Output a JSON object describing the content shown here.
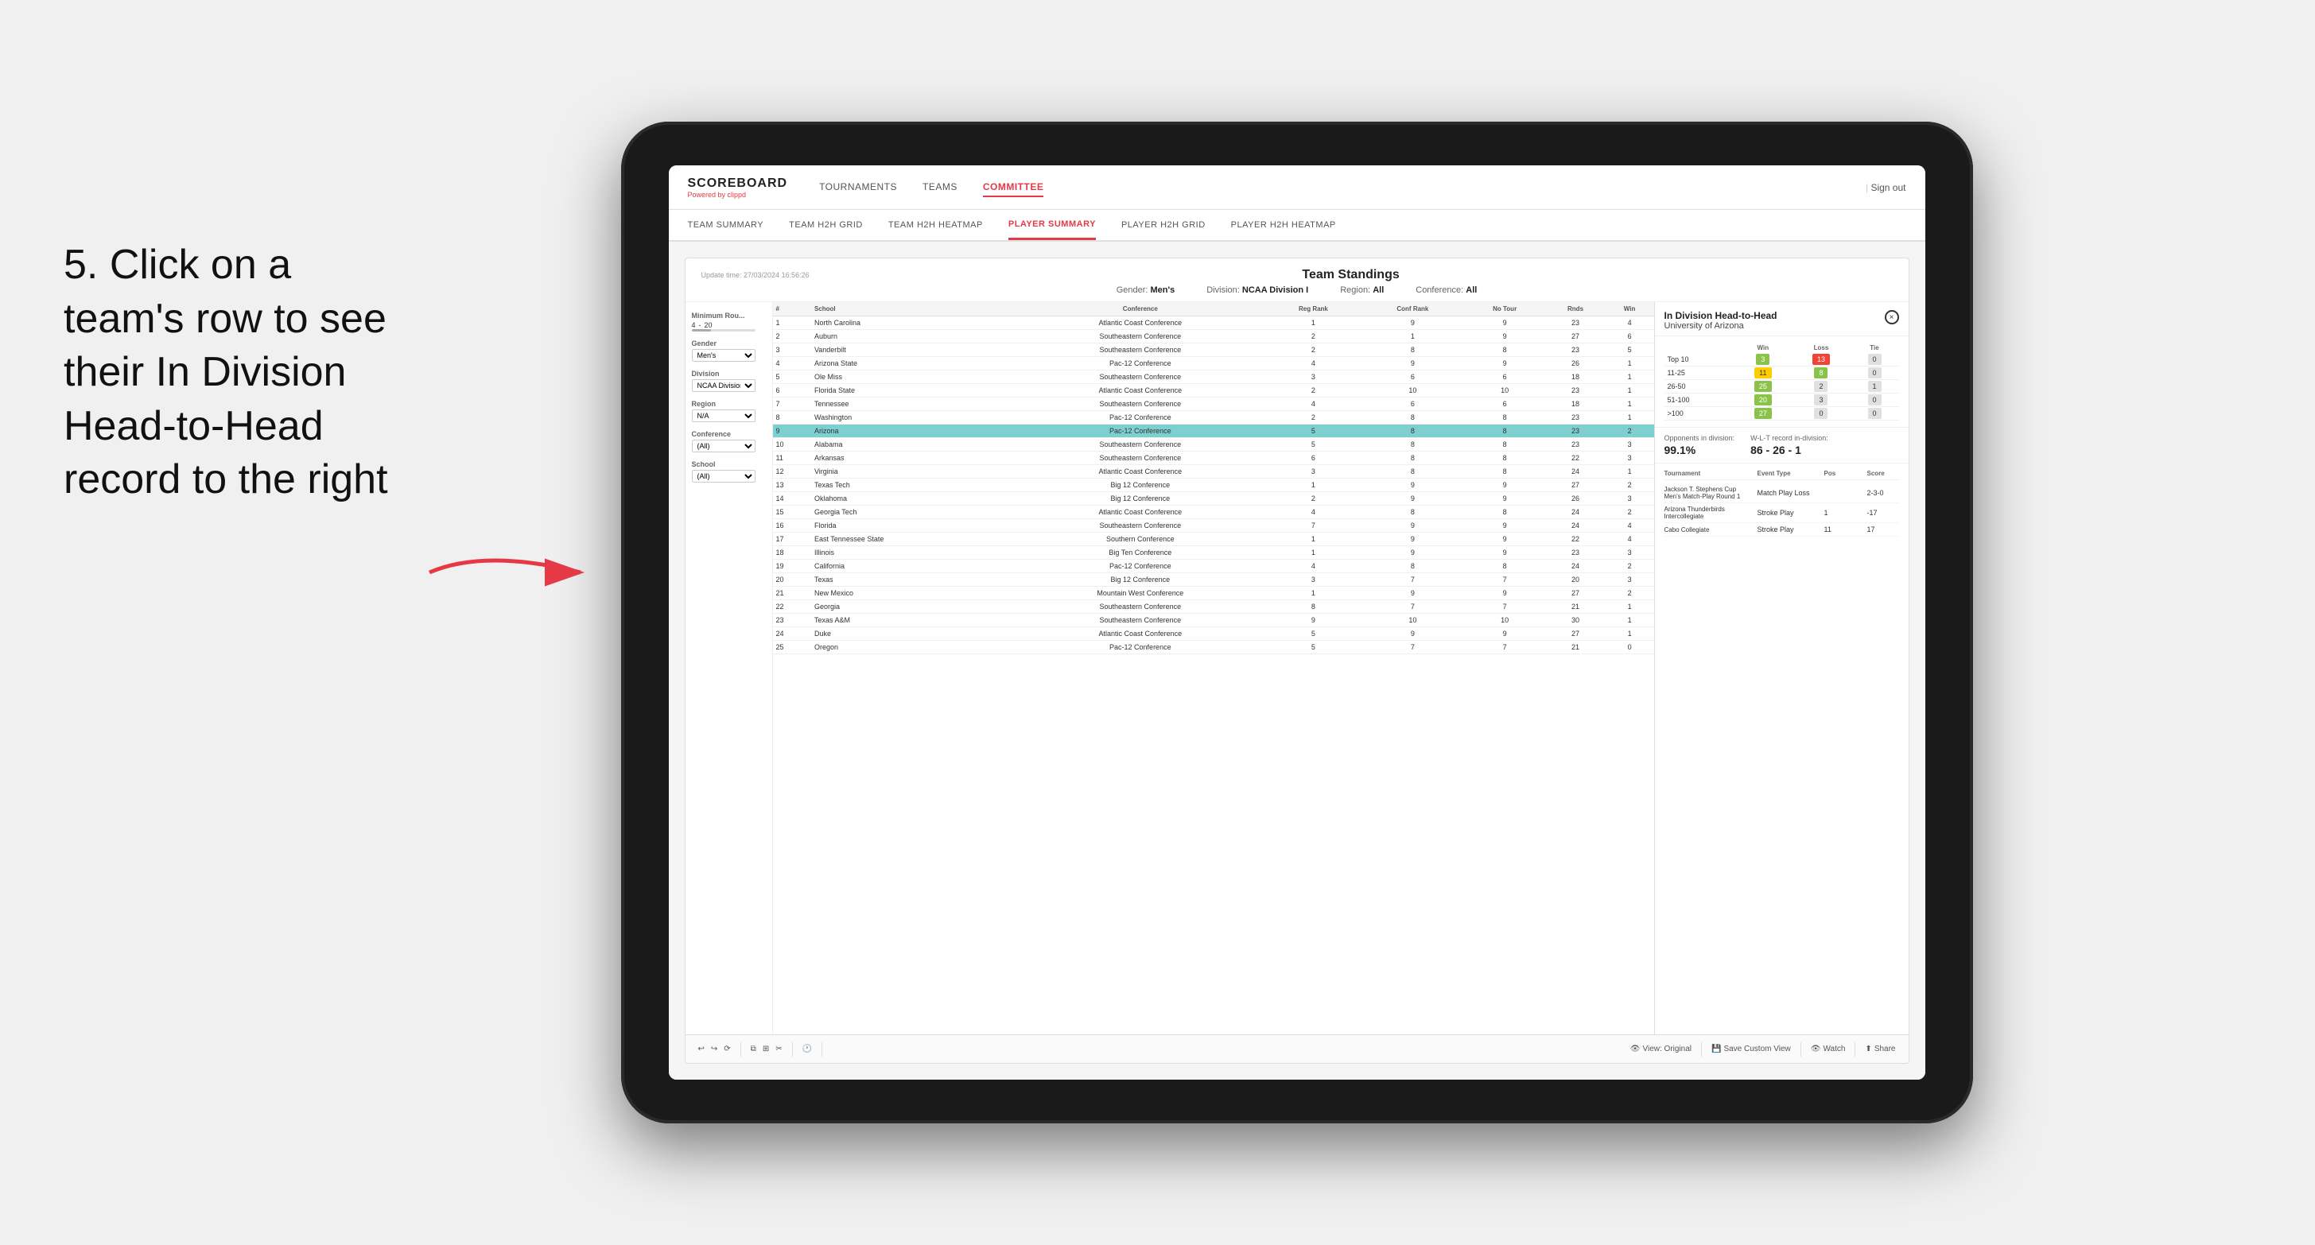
{
  "nav": {
    "logo": "SCOREBOARD",
    "logo_sub": "Powered by",
    "logo_brand": "clippd",
    "items": [
      "TOURNAMENTS",
      "TEAMS",
      "COMMITTEE"
    ],
    "active_item": "COMMITTEE",
    "sign_out": "Sign out"
  },
  "sub_nav": {
    "items": [
      "TEAM SUMMARY",
      "TEAM H2H GRID",
      "TEAM H2H HEATMAP",
      "PLAYER SUMMARY",
      "PLAYER H2H GRID",
      "PLAYER H2H HEATMAP"
    ],
    "active_item": "PLAYER SUMMARY"
  },
  "panel": {
    "update_time": "Update time: 27/03/2024 16:56:26",
    "title": "Team Standings",
    "filters": {
      "gender_label": "Gender:",
      "gender_value": "Men's",
      "division_label": "Division:",
      "division_value": "NCAA Division I",
      "region_label": "Region:",
      "region_value": "All",
      "conference_label": "Conference:",
      "conference_value": "All"
    }
  },
  "sidebar": {
    "min_rounds_label": "Minimum Rou...",
    "min_rounds_value": "4",
    "min_rounds_max": "20",
    "gender_label": "Gender",
    "gender_value": "Men's",
    "division_label": "Division",
    "division_value": "NCAA Division I",
    "region_label": "Region",
    "region_value": "N/A",
    "conference_label": "Conference",
    "conference_value": "(All)",
    "school_label": "School",
    "school_value": "(All)"
  },
  "table": {
    "headers": [
      "#",
      "School",
      "Conference",
      "Reg Rank",
      "Conf Rank",
      "No Tour",
      "Rnds",
      "Win"
    ],
    "rows": [
      {
        "rank": 1,
        "school": "North Carolina",
        "conference": "Atlantic Coast Conference",
        "reg_rank": 1,
        "conf_rank": 9,
        "no_tour": 9,
        "rnds": 23,
        "win": 4
      },
      {
        "rank": 2,
        "school": "Auburn",
        "conference": "Southeastern Conference",
        "reg_rank": 2,
        "conf_rank": 1,
        "no_tour": 9,
        "rnds": 27,
        "win": 6
      },
      {
        "rank": 3,
        "school": "Vanderbilt",
        "conference": "Southeastern Conference",
        "reg_rank": 2,
        "conf_rank": 8,
        "no_tour": 8,
        "rnds": 23,
        "win": 5
      },
      {
        "rank": 4,
        "school": "Arizona State",
        "conference": "Pac-12 Conference",
        "reg_rank": 4,
        "conf_rank": 9,
        "no_tour": 9,
        "rnds": 26,
        "win": 1
      },
      {
        "rank": 5,
        "school": "Ole Miss",
        "conference": "Southeastern Conference",
        "reg_rank": 3,
        "conf_rank": 6,
        "no_tour": 6,
        "rnds": 18,
        "win": 1
      },
      {
        "rank": 6,
        "school": "Florida State",
        "conference": "Atlantic Coast Conference",
        "reg_rank": 2,
        "conf_rank": 10,
        "no_tour": 10,
        "rnds": 23,
        "win": 1
      },
      {
        "rank": 7,
        "school": "Tennessee",
        "conference": "Southeastern Conference",
        "reg_rank": 4,
        "conf_rank": 6,
        "no_tour": 6,
        "rnds": 18,
        "win": 1
      },
      {
        "rank": 8,
        "school": "Washington",
        "conference": "Pac-12 Conference",
        "reg_rank": 2,
        "conf_rank": 8,
        "no_tour": 8,
        "rnds": 23,
        "win": 1
      },
      {
        "rank": 9,
        "school": "Arizona",
        "conference": "Pac-12 Conference",
        "reg_rank": 5,
        "conf_rank": 8,
        "no_tour": 8,
        "rnds": 23,
        "win": 2,
        "highlighted": true
      },
      {
        "rank": 10,
        "school": "Alabama",
        "conference": "Southeastern Conference",
        "reg_rank": 5,
        "conf_rank": 8,
        "no_tour": 8,
        "rnds": 23,
        "win": 3
      },
      {
        "rank": 11,
        "school": "Arkansas",
        "conference": "Southeastern Conference",
        "reg_rank": 6,
        "conf_rank": 8,
        "no_tour": 8,
        "rnds": 22,
        "win": 3
      },
      {
        "rank": 12,
        "school": "Virginia",
        "conference": "Atlantic Coast Conference",
        "reg_rank": 3,
        "conf_rank": 8,
        "no_tour": 8,
        "rnds": 24,
        "win": 1
      },
      {
        "rank": 13,
        "school": "Texas Tech",
        "conference": "Big 12 Conference",
        "reg_rank": 1,
        "conf_rank": 9,
        "no_tour": 9,
        "rnds": 27,
        "win": 2
      },
      {
        "rank": 14,
        "school": "Oklahoma",
        "conference": "Big 12 Conference",
        "reg_rank": 2,
        "conf_rank": 9,
        "no_tour": 9,
        "rnds": 26,
        "win": 3
      },
      {
        "rank": 15,
        "school": "Georgia Tech",
        "conference": "Atlantic Coast Conference",
        "reg_rank": 4,
        "conf_rank": 8,
        "no_tour": 8,
        "rnds": 24,
        "win": 2
      },
      {
        "rank": 16,
        "school": "Florida",
        "conference": "Southeastern Conference",
        "reg_rank": 7,
        "conf_rank": 9,
        "no_tour": 9,
        "rnds": 24,
        "win": 4
      },
      {
        "rank": 17,
        "school": "East Tennessee State",
        "conference": "Southern Conference",
        "reg_rank": 1,
        "conf_rank": 9,
        "no_tour": 9,
        "rnds": 22,
        "win": 4
      },
      {
        "rank": 18,
        "school": "Illinois",
        "conference": "Big Ten Conference",
        "reg_rank": 1,
        "conf_rank": 9,
        "no_tour": 9,
        "rnds": 23,
        "win": 3
      },
      {
        "rank": 19,
        "school": "California",
        "conference": "Pac-12 Conference",
        "reg_rank": 4,
        "conf_rank": 8,
        "no_tour": 8,
        "rnds": 24,
        "win": 2
      },
      {
        "rank": 20,
        "school": "Texas",
        "conference": "Big 12 Conference",
        "reg_rank": 3,
        "conf_rank": 7,
        "no_tour": 7,
        "rnds": 20,
        "win": 3
      },
      {
        "rank": 21,
        "school": "New Mexico",
        "conference": "Mountain West Conference",
        "reg_rank": 1,
        "conf_rank": 9,
        "no_tour": 9,
        "rnds": 27,
        "win": 2
      },
      {
        "rank": 22,
        "school": "Georgia",
        "conference": "Southeastern Conference",
        "reg_rank": 8,
        "conf_rank": 7,
        "no_tour": 7,
        "rnds": 21,
        "win": 1
      },
      {
        "rank": 23,
        "school": "Texas A&M",
        "conference": "Southeastern Conference",
        "reg_rank": 9,
        "conf_rank": 10,
        "no_tour": 10,
        "rnds": 30,
        "win": 1
      },
      {
        "rank": 24,
        "school": "Duke",
        "conference": "Atlantic Coast Conference",
        "reg_rank": 5,
        "conf_rank": 9,
        "no_tour": 9,
        "rnds": 27,
        "win": 1
      },
      {
        "rank": 25,
        "school": "Oregon",
        "conference": "Pac-12 Conference",
        "reg_rank": 5,
        "conf_rank": 7,
        "no_tour": 7,
        "rnds": 21,
        "win": 0
      }
    ]
  },
  "h2h": {
    "title": "In Division Head-to-Head",
    "team": "University of Arizona",
    "close_btn": "×",
    "win_label": "Win",
    "loss_label": "Loss",
    "tie_label": "Tie",
    "records": [
      {
        "range": "Top 10",
        "win": 3,
        "loss": 13,
        "tie": 0,
        "win_color": "green",
        "loss_color": "red"
      },
      {
        "range": "11-25",
        "win": 11,
        "loss": 8,
        "tie": 0,
        "win_color": "yellow",
        "loss_color": "green"
      },
      {
        "range": "26-50",
        "win": 25,
        "loss": 2,
        "tie": 1,
        "win_color": "green",
        "loss_color": "neutral"
      },
      {
        "range": "51-100",
        "win": 20,
        "loss": 3,
        "tie": 0,
        "win_color": "green",
        "loss_color": "neutral"
      },
      {
        "range": ">100",
        "win": 27,
        "loss": 0,
        "tie": 0,
        "win_color": "green",
        "loss_color": "neutral"
      }
    ],
    "opponents_label": "Opponents in division:",
    "opponents_value": "99.1%",
    "wlt_label": "W-L-T record in-division:",
    "wlt_value": "86 - 26 - 1",
    "tournament_col_headers": [
      "Tournament",
      "Event Type",
      "Pos",
      "Score"
    ],
    "tournaments": [
      {
        "name": "Jackson T. Stephens Cup Men's Match-Play Round 1",
        "type": "Match Play",
        "result": "Loss",
        "score": "2-3-0"
      },
      {
        "name": "Arizona Thunderbirds Intercollegiate",
        "type": "Stroke Play",
        "pos": 1,
        "score": "-17"
      },
      {
        "name": "Cabo Collegiate",
        "type": "Stroke Play",
        "pos": 11,
        "score": "17"
      }
    ]
  },
  "toolbar": {
    "view_original": "View: Original",
    "save_custom": "Save Custom View",
    "watch": "Watch",
    "share": "Share"
  },
  "annotation": {
    "text": "5. Click on a team's row to see their In Division Head-to-Head record to the right"
  }
}
